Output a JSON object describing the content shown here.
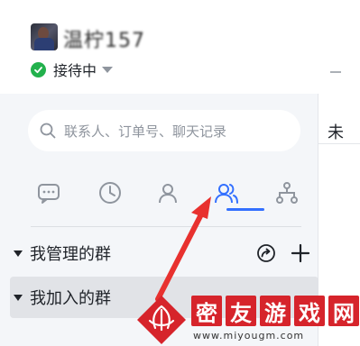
{
  "header": {
    "username": "温柠157",
    "status_label": "接待中"
  },
  "search": {
    "placeholder": "联系人、订单号、聊天记录"
  },
  "tabs": [
    {
      "icon": "chat-bubble-icon",
      "active": false
    },
    {
      "icon": "clock-icon",
      "active": false
    },
    {
      "icon": "person-icon",
      "active": false
    },
    {
      "icon": "contacts-group-icon",
      "active": true
    },
    {
      "icon": "org-tree-icon",
      "active": false
    }
  ],
  "groups": {
    "managed_label": "我管理的群",
    "joined_label": "我加入的群"
  },
  "right_panel": {
    "text": "未"
  },
  "watermark": {
    "title": "密友游戏网",
    "url": "www.miyougm.com"
  },
  "colors": {
    "accent": "#3370ff",
    "status_green": "#22b14c",
    "arrow_red": "#e8312f",
    "watermark_red": "#d6242b"
  }
}
